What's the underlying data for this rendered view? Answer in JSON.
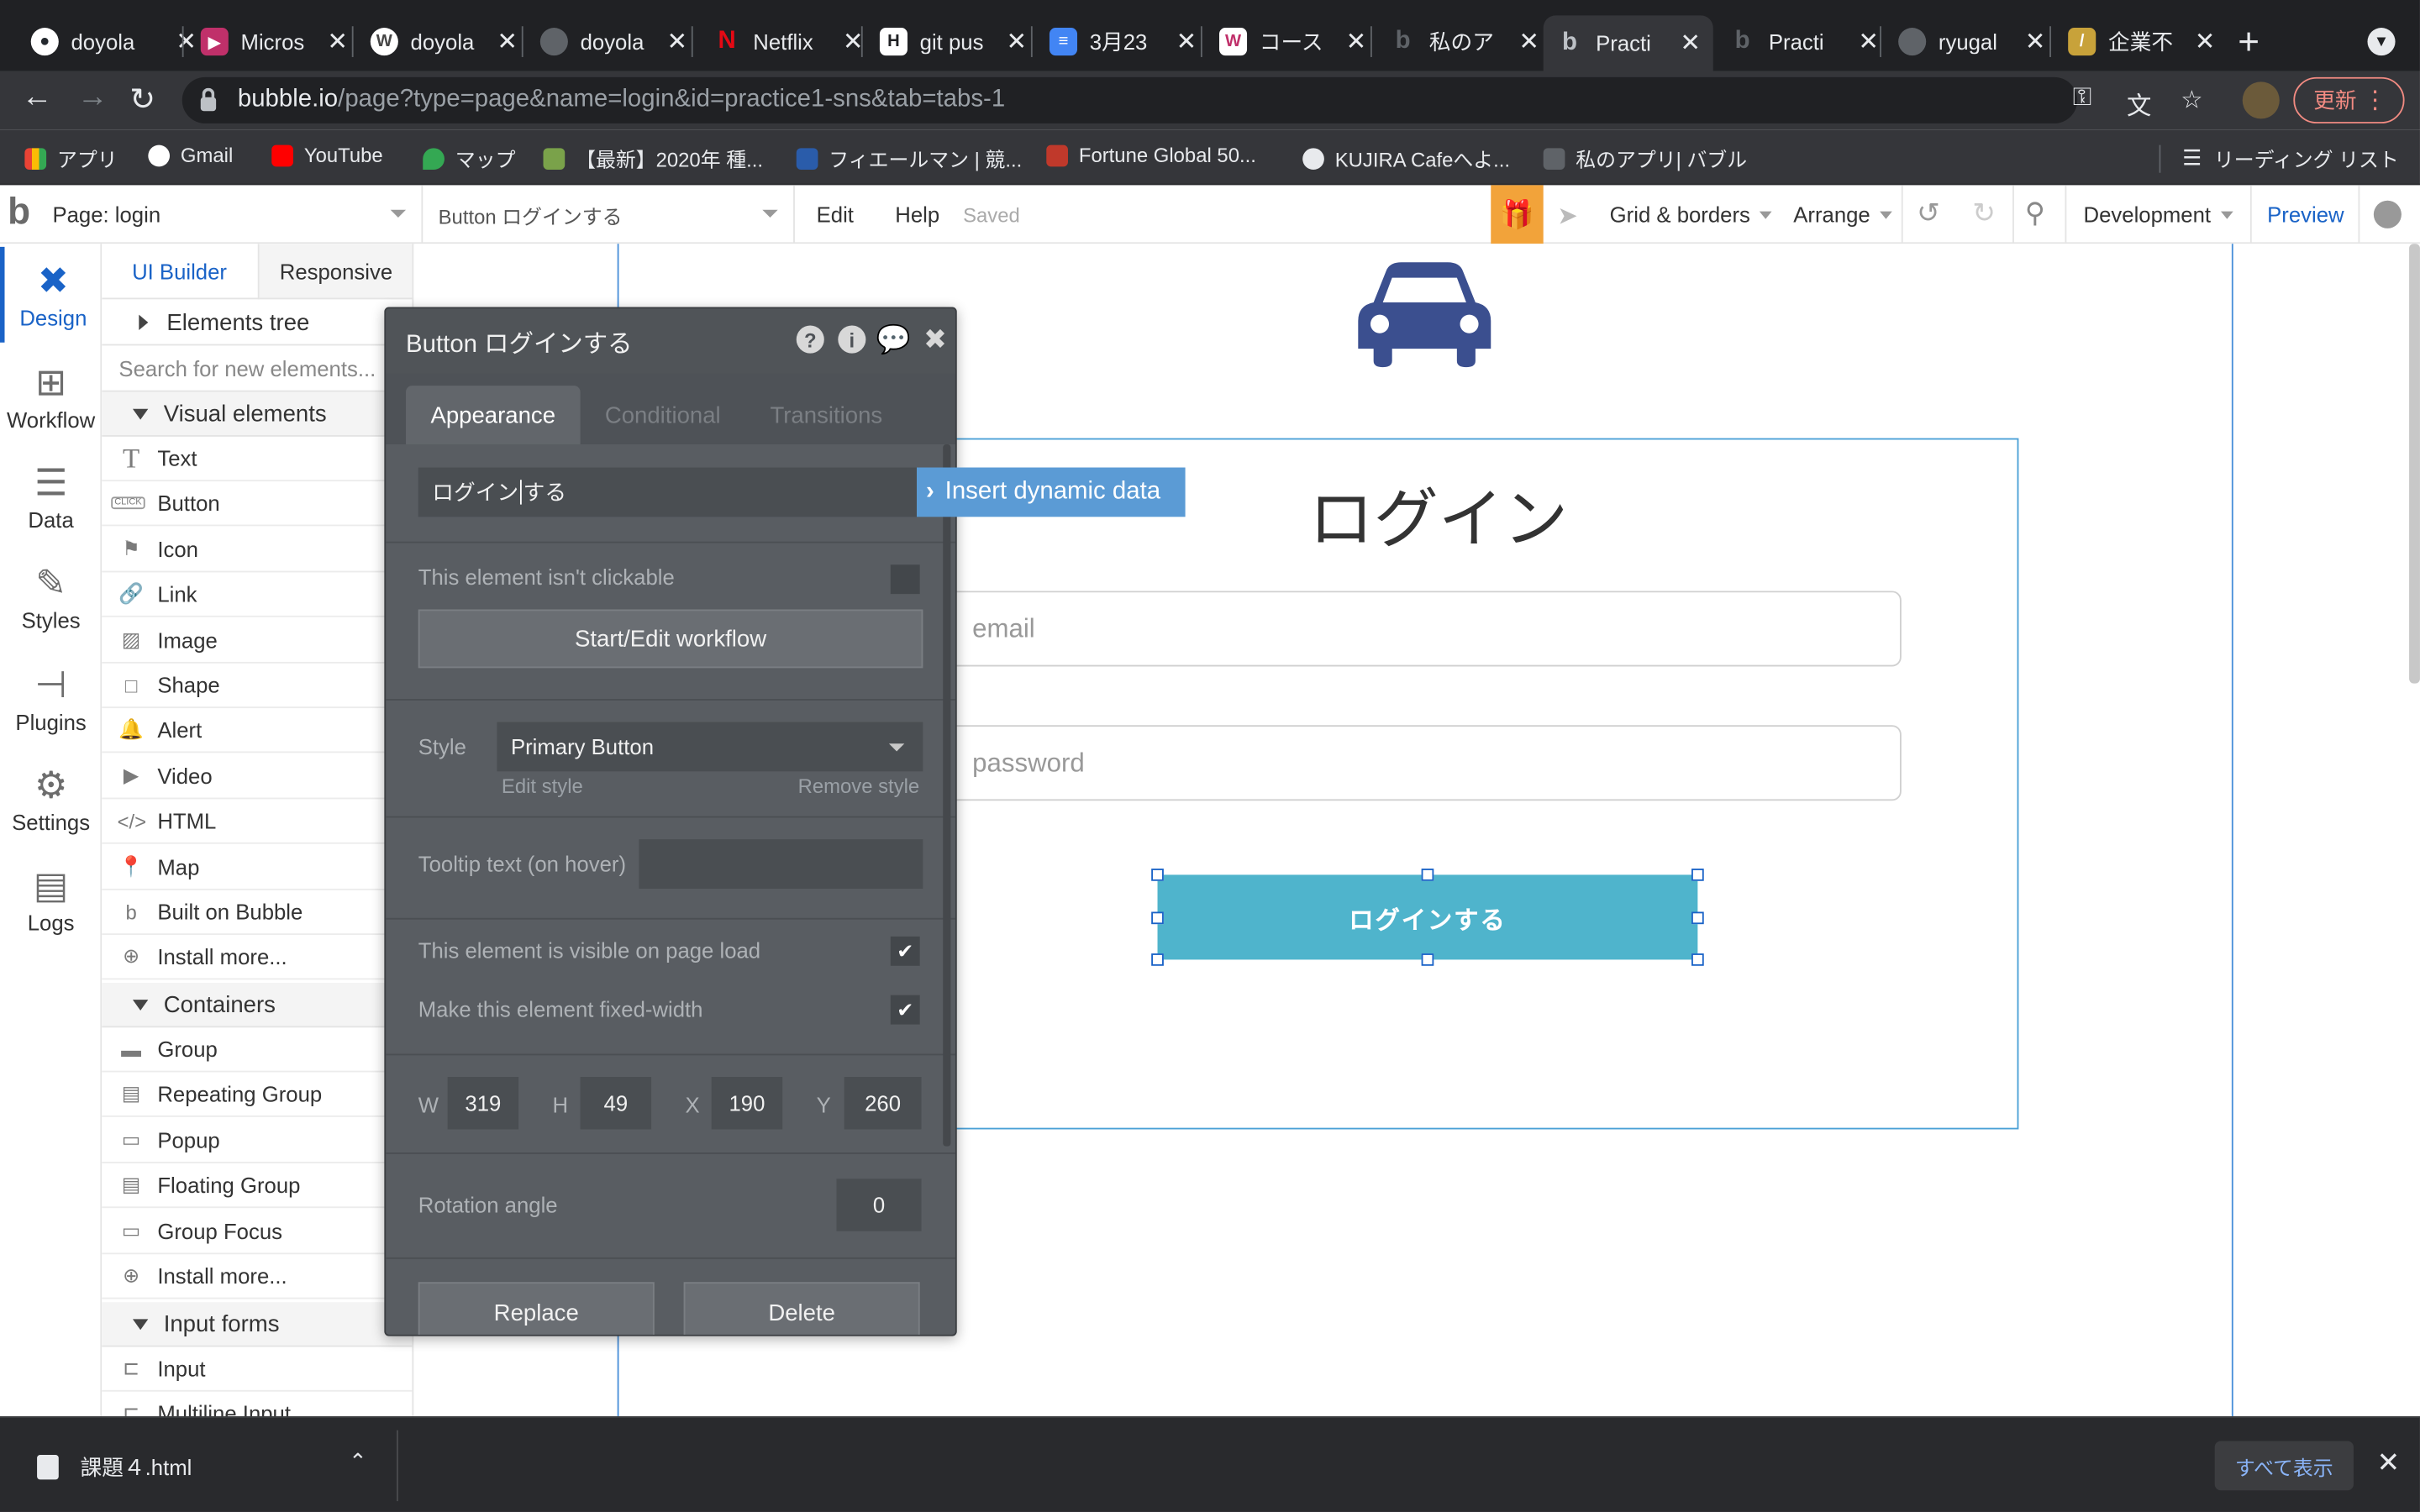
{
  "browser": {
    "tabs": [
      {
        "title": "doyola",
        "icon": "github-icon",
        "color": "#24292e"
      },
      {
        "title": "Micros",
        "icon": "powerapps-icon",
        "color": "#c0306a"
      },
      {
        "title": "doyola",
        "icon": "wordpress-icon",
        "color": "#464646"
      },
      {
        "title": "doyola",
        "icon": "globe-icon",
        "color": "#5f6368"
      },
      {
        "title": "Netflix",
        "icon": "netflix-icon",
        "color": "#e50914"
      },
      {
        "title": "git pus",
        "icon": "hatena-icon",
        "color": "#ffffff"
      },
      {
        "title": "3月23",
        "icon": "docs-icon",
        "color": "#4285f4"
      },
      {
        "title": "コース",
        "icon": "w-icon",
        "color": "#ffffff"
      },
      {
        "title": "私のア",
        "icon": "bubble-icon",
        "color": "#202124"
      },
      {
        "title": "Practi",
        "icon": "bubble-icon",
        "color": "#202124"
      },
      {
        "title": "Practi",
        "icon": "bubble-icon",
        "color": "#202124"
      },
      {
        "title": "ryugal",
        "icon": "globe-icon",
        "color": "#5f6368"
      },
      {
        "title": "企業不",
        "icon": "stripes-icon",
        "color": "#c8a23a"
      }
    ],
    "url_host": "bubble.io",
    "url_path": "/page?type=page&name=login&id=practice1-sns&tab=tabs-1",
    "update_label": "更新",
    "bookmarks": [
      {
        "label": "アプリ",
        "color": "#ea4335"
      },
      {
        "label": "Gmail",
        "color": "#ffffff"
      },
      {
        "label": "YouTube",
        "color": "#ff0000"
      },
      {
        "label": "マップ",
        "color": "#34a853"
      },
      {
        "label": "【最新】2020年 種...",
        "color": "#7aa24a"
      },
      {
        "label": "フィエールマン | 競...",
        "color": "#2a5caa"
      },
      {
        "label": "Fortune Global 50...",
        "color": "#c0392b"
      },
      {
        "label": "KUJIRA Cafeへよ...",
        "color": "#e8eaed"
      },
      {
        "label": "私のアプリ| バブル",
        "color": "#5f6368"
      }
    ],
    "reading_list": "リーディング リスト"
  },
  "bubble": {
    "page_select": "Page: login",
    "element_select": "Button ログインする",
    "menu": {
      "edit": "Edit",
      "help": "Help",
      "saved": "Saved"
    },
    "grid": "Grid & borders",
    "arrange": "Arrange",
    "env": "Development",
    "preview": "Preview",
    "rail": [
      {
        "label": "Design",
        "icon": "design-icon"
      },
      {
        "label": "Workflow",
        "icon": "workflow-icon"
      },
      {
        "label": "Data",
        "icon": "data-icon"
      },
      {
        "label": "Styles",
        "icon": "styles-icon"
      },
      {
        "label": "Plugins",
        "icon": "plugins-icon"
      },
      {
        "label": "Settings",
        "icon": "settings-icon"
      },
      {
        "label": "Logs",
        "icon": "logs-icon"
      }
    ],
    "palette": {
      "tab_builder": "UI Builder",
      "tab_responsive": "Responsive",
      "elements_tree": "Elements tree",
      "search_placeholder": "Search for new elements...",
      "visual_header": "Visual elements",
      "visual": [
        {
          "label": "Text",
          "glyph": "T"
        },
        {
          "label": "Button",
          "glyph": "CLICK"
        },
        {
          "label": "Icon",
          "glyph": "⚑"
        },
        {
          "label": "Link",
          "glyph": "🔗"
        },
        {
          "label": "Image",
          "glyph": "▨"
        },
        {
          "label": "Shape",
          "glyph": "□"
        },
        {
          "label": "Alert",
          "glyph": "🔔"
        },
        {
          "label": "Video",
          "glyph": "▶"
        },
        {
          "label": "HTML",
          "glyph": "</>"
        },
        {
          "label": "Map",
          "glyph": "📍"
        },
        {
          "label": "Built on Bubble",
          "glyph": "b"
        },
        {
          "label": "Install more...",
          "glyph": "⊕"
        }
      ],
      "containers_header": "Containers",
      "containers": [
        {
          "label": "Group",
          "glyph": "▬"
        },
        {
          "label": "Repeating Group",
          "glyph": "▤"
        },
        {
          "label": "Popup",
          "glyph": "▭"
        },
        {
          "label": "Floating Group",
          "glyph": "▤"
        },
        {
          "label": "Group Focus",
          "glyph": "▭"
        },
        {
          "label": "Install more...",
          "glyph": "⊕"
        }
      ],
      "inputs_header": "Input forms",
      "inputs": [
        {
          "label": "Input",
          "glyph": "⊏"
        },
        {
          "label": "Multiline Input",
          "glyph": "⊏"
        }
      ]
    },
    "canvas": {
      "title": "ログイン",
      "email_placeholder": "email",
      "password_placeholder": "password",
      "button_label": "ログインする",
      "button_color": "#4fb4cc"
    },
    "editor": {
      "title": "Button ログインする",
      "tabs": [
        "Appearance",
        "Conditional",
        "Transitions"
      ],
      "text_value_a": "ログイン",
      "text_value_b": "する",
      "dynamic_data": "Insert dynamic data",
      "not_clickable": "This element isn't clickable",
      "workflow_btn": "Start/Edit workflow",
      "style_label": "Style",
      "style_value": "Primary Button",
      "edit_style": "Edit style",
      "remove_style": "Remove style",
      "tooltip_label": "Tooltip text (on hover)",
      "visible_label": "This element is visible on page load",
      "fixed_label": "Make this element fixed-width",
      "w_label": "W",
      "w": "319",
      "h_label": "H",
      "h": "49",
      "x_label": "X",
      "x": "190",
      "y_label": "Y",
      "y": "260",
      "rotation_label": "Rotation angle",
      "rotation": "0",
      "replace": "Replace",
      "delete": "Delete"
    }
  },
  "downloads": {
    "file": "課題４.html",
    "show_all": "すべて表示"
  }
}
